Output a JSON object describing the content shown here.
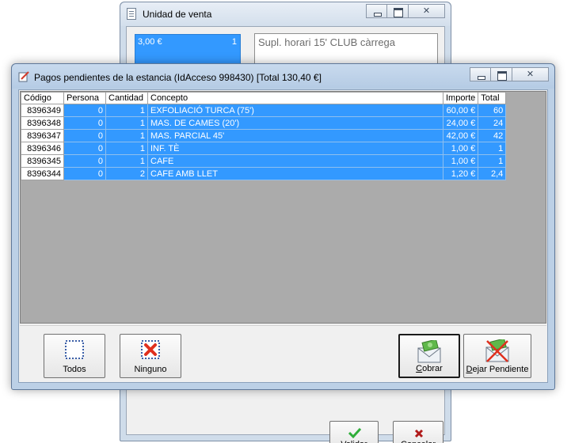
{
  "unidad_window": {
    "title": "Unidad de venta",
    "price_tile": {
      "amount": "3,00 €",
      "quantity": "1"
    },
    "description": "Supl. horari 15' CLUB càrrega",
    "validar": {
      "accel": "V",
      "rest": "alidar"
    },
    "cancelar": {
      "accel": "C",
      "rest": "ancelar"
    }
  },
  "pagos_window": {
    "title": "Pagos pendientes de la estancia (IdAcceso 998430) [Total 130,40 €]",
    "columns": [
      "Código",
      "Persona",
      "Cantidad",
      "Concepto",
      "Importe",
      "Total"
    ],
    "rows": [
      [
        "8396349",
        "0",
        "1",
        "EXFOLIACIÓ TURCA (75')",
        "60,00 €",
        "60"
      ],
      [
        "8396348",
        "0",
        "1",
        "MAS. DE CAMES (20')",
        "24,00 €",
        "24"
      ],
      [
        "8396347",
        "0",
        "1",
        "MAS. PARCIAL 45'",
        "42,00 €",
        "42"
      ],
      [
        "8396346",
        "0",
        "1",
        "INF. TÈ",
        "1,00 €",
        "1"
      ],
      [
        "8396345",
        "0",
        "1",
        "CAFE",
        "1,00 €",
        "1"
      ],
      [
        "8396344",
        "0",
        "2",
        "CAFE AMB LLET",
        "1,20 €",
        "2,4"
      ]
    ],
    "buttons": {
      "todos": "Todos",
      "ninguno": "Ninguno",
      "cobrar": {
        "accel": "C",
        "rest": "obrar"
      },
      "dejar": {
        "accel": "D",
        "rest": "ejar Pendiente"
      }
    }
  },
  "colors": {
    "selection": "#3399ff",
    "grid_background": "#ababab",
    "window_frame": "#bcd0e6"
  },
  "icons": {
    "todos": "dotted-square-icon",
    "ninguno": "red-x-square-icon",
    "cobrar": "money-envelope-icon",
    "dejar": "crossed-money-envelope-icon",
    "validar": "green-check-icon",
    "cancelar": "red-x-icon",
    "pagos_title": "edit-note-icon"
  }
}
